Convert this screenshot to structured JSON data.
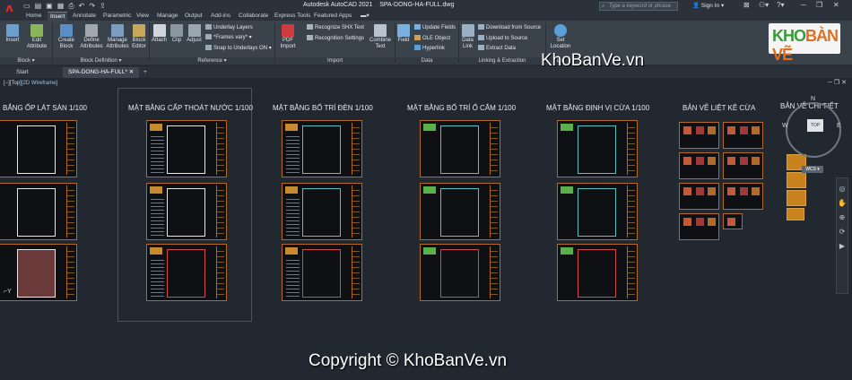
{
  "app": {
    "title": "Autodesk AutoCAD 2021",
    "file": "SPA-DONG-HA-FULL.dwg",
    "search_placeholder": "Type a keyword or phrase",
    "signin": "Sign In",
    "logo_letter": "A"
  },
  "menu_tabs": [
    "Home",
    "Insert",
    "Annotate",
    "Parametric",
    "View",
    "Manage",
    "Output",
    "Add-ins",
    "Collaborate",
    "Express Tools",
    "Featured Apps"
  ],
  "active_menu_tab": "Insert",
  "ribbon": {
    "insert": "Insert",
    "edit_attribute": "Edit Attribute",
    "create_block": "Create Block",
    "define_attributes": "Define Attributes",
    "manage_attributes": "Manage Attributes",
    "block_editor": "Block Editor",
    "attach": "Attach",
    "clip": "Clip",
    "adjust": "Adjust",
    "underlay_layers": "Underlay Layers",
    "frames_vary": "*Frames vary*",
    "snap_underlays": "Snap to Underlays ON",
    "pdf_import": "PDF Import",
    "recognize_shx": "Recognize SHX Text",
    "recognition_settings": "Recognition Settings",
    "combine_text": "Combine Text",
    "field": "Field",
    "update_fields": "Update Fields",
    "ole_object": "OLE Object",
    "hyperlink": "Hyperlink",
    "data_link": "Data Link",
    "download_source": "Download from Source",
    "upload_source": "Upload to Source",
    "extract_data": "Extract  Data",
    "set_location": "Set Location",
    "panels": {
      "block": "Block",
      "block_definition": "Block Definition",
      "reference": "Reference",
      "import": "Import",
      "data": "Data",
      "linking": "Linking & Extraction",
      "location": "Lo"
    }
  },
  "doc_tabs": [
    "Start",
    "SPA-DONG-HA-FULL*"
  ],
  "viewport": {
    "label_prefix": "[−][Top]",
    "label_style": "[2D Wireframe]"
  },
  "sections": [
    "BẮNG ỐP LÁT SÀN 1/100",
    "MẶT BẰNG CẤP THOÁT NƯỚC 1/100",
    "MẶT BẰNG BỐ TRÍ ĐÈN 1/100",
    "MẶT BẰNG BỐ TRÍ Ổ CẮM 1/100",
    "MẶT BẰNG ĐỊNH VỊ CỪA 1/100",
    "BẢN VẼ LIỆT KÊ CỪA",
    "BẢN VẼ CHI TIẾT"
  ],
  "compass": {
    "n": "N",
    "w": "W",
    "e": "E",
    "top": "TOP",
    "wcs": "WCS"
  },
  "watermark": {
    "brand_a": "KHO",
    "brand_b": "BÀN VẼ",
    "mid": "KhoBanVe.vn",
    "copyright": "Copyright © KhoBanVe.vn"
  },
  "colors": {
    "accent": "#c78a2e",
    "sheet_border": "#b56a22",
    "background": "#212830"
  }
}
